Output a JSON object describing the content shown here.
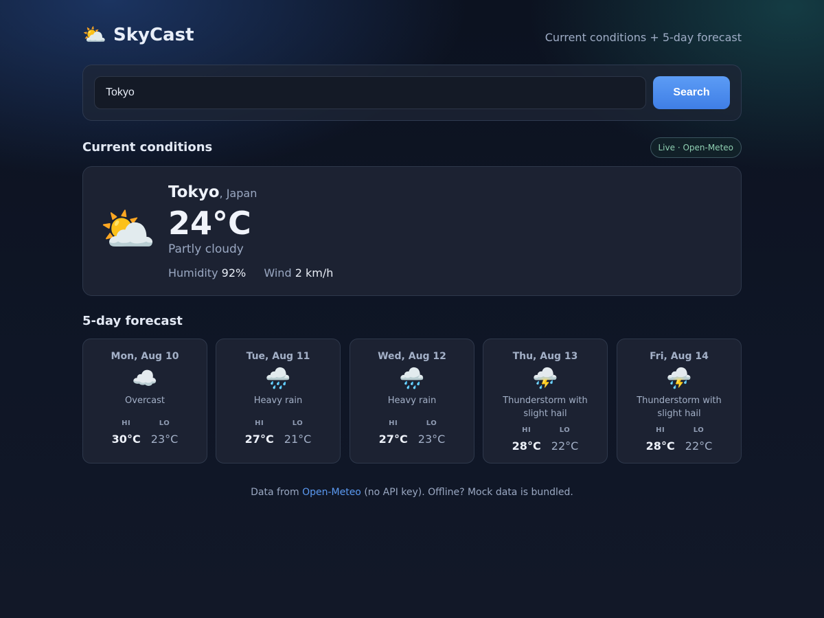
{
  "app": {
    "logo_icon": "sun-behind-cloud",
    "logo_glyph": "⛅",
    "name": "SkyCast",
    "tagline": "Current conditions + 5-day forecast"
  },
  "search": {
    "value": "Tokyo",
    "button_label": "Search"
  },
  "current": {
    "section_title": "Current conditions",
    "badge": "Live · Open-Meteo",
    "icon": "sun-behind-cloud",
    "icon_glyph": "⛅",
    "city": "Tokyo",
    "country": ", Japan",
    "temperature": "24°C",
    "condition": "Partly cloudy",
    "humidity_label": "Humidity",
    "humidity_value": "92%",
    "wind_label": "Wind",
    "wind_value": "2 km/h"
  },
  "forecast": {
    "section_title": "5-day forecast",
    "hi_label": "HI",
    "lo_label": "LO",
    "days": [
      {
        "date": "Mon, Aug 10",
        "icon": "cloud",
        "icon_glyph": "☁️",
        "condition": "Overcast",
        "hi": "30°C",
        "lo": "23°C"
      },
      {
        "date": "Tue, Aug 11",
        "icon": "cloud-with-rain",
        "icon_glyph": "🌧️",
        "condition": "Heavy rain",
        "hi": "27°C",
        "lo": "21°C"
      },
      {
        "date": "Wed, Aug 12",
        "icon": "cloud-with-rain",
        "icon_glyph": "🌧️",
        "condition": "Heavy rain",
        "hi": "27°C",
        "lo": "23°C"
      },
      {
        "date": "Thu, Aug 13",
        "icon": "thunderstorm",
        "icon_glyph": "⛈️",
        "condition": "Thunderstorm with slight hail",
        "hi": "28°C",
        "lo": "22°C"
      },
      {
        "date": "Fri, Aug 14",
        "icon": "thunderstorm",
        "icon_glyph": "⛈️",
        "condition": "Thunderstorm with slight hail",
        "hi": "28°C",
        "lo": "22°C"
      }
    ]
  },
  "footer": {
    "prefix": "Data from ",
    "link_text": "Open-Meteo",
    "suffix": " (no API key). Offline? Mock data is bundled."
  },
  "colors": {
    "accent": "#4a8cf0",
    "badge_text": "#8fd0b2",
    "card_bg": "#1c2232",
    "page_bg": "#0f1626"
  }
}
